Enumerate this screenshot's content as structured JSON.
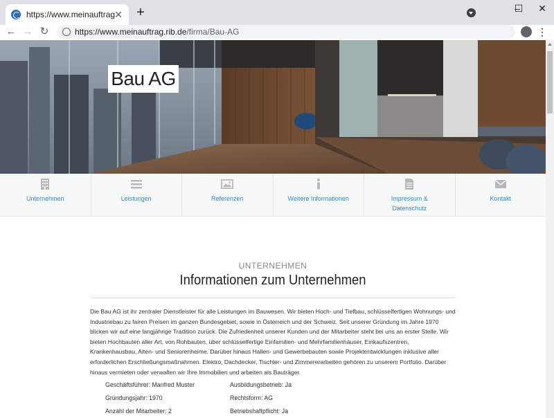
{
  "browser": {
    "tab_title": "https://www.meinauftrag.rib.de/f",
    "new_tab_symbol": "+",
    "close_symbol": "✕",
    "url_host": "https://www.meinauftrag.rib.de",
    "url_path": "/firma/Bau-AG",
    "window_controls": [
      "–",
      "☐",
      "✕"
    ],
    "nav": {
      "back": "←",
      "forward": "→",
      "reload": "↻"
    },
    "menu_symbol": "⋮"
  },
  "hero": {
    "title": "Bau AG"
  },
  "nav_items": [
    {
      "label": "Unternehmen",
      "icon": "building-icon"
    },
    {
      "label": "Leistungen",
      "icon": "list-icon"
    },
    {
      "label": "Referenzen",
      "icon": "image-icon"
    },
    {
      "label": "Weitere Informationen",
      "icon": "info-icon"
    },
    {
      "label": "Impressum & Datenschutz",
      "icon": "document-icon"
    },
    {
      "label": "Kontakt",
      "icon": "envelope-icon"
    }
  ],
  "section": {
    "overline": "UNTERNEHMEN",
    "title": "Informationen zum Unternehmen",
    "body": "Die Bau AG ist ihr zentraler Dienstleister für alle Leistungen im Bauwesen. Wir bieten Hoch- und Tiefbau, schlüsselfertigen Wohnungs- und Industriebau zu fairen Preisen im ganzen Bundesgebiet, sowie in Österreich und der Schweiz. Seit unserer Gründung im Jahre 1970 blicken wir auf eine langjährige Tradition zurück. Die Zufriedenheit unserer Kunden und der Mitarbeiter steht bei uns an erster Stelle. Wir bieten Hochbauten aller Art, von Rohbauten, über schlüsselfertige Einfamilien- und Mehrfamilienhäuser, Einkaufszentren, Krankenhausbau, Alten- und Seniorenheime. Darüber hinaus Hallen- und Gewerbebauten sowie Projektentwicklungen inklusive aller erforderlichen Erschließungsmaßnahmen. Elektro, Dachdecker, Tischler- und Zimmererarbeiten gehören zu unserem Portfolio. Darüber hinaus vermieten oder verwalten wir Ihre Immobilien und arbeiten als Bauträger."
  },
  "facts": {
    "left": [
      "Geschäftsführer: Manfred Muster",
      "Gründungsjahr: 1970",
      "Anzahl der Mitarbeiter: 2"
    ],
    "right": [
      "Ausbildungsbetrieb: Ja",
      "Rechtsform: AG",
      "Betriebshaftpflicht: Ja"
    ]
  },
  "colors": {
    "link": "#2a8ad1",
    "nav_bg": "#f7f8f8",
    "icon_grey": "#b6b9bc"
  }
}
